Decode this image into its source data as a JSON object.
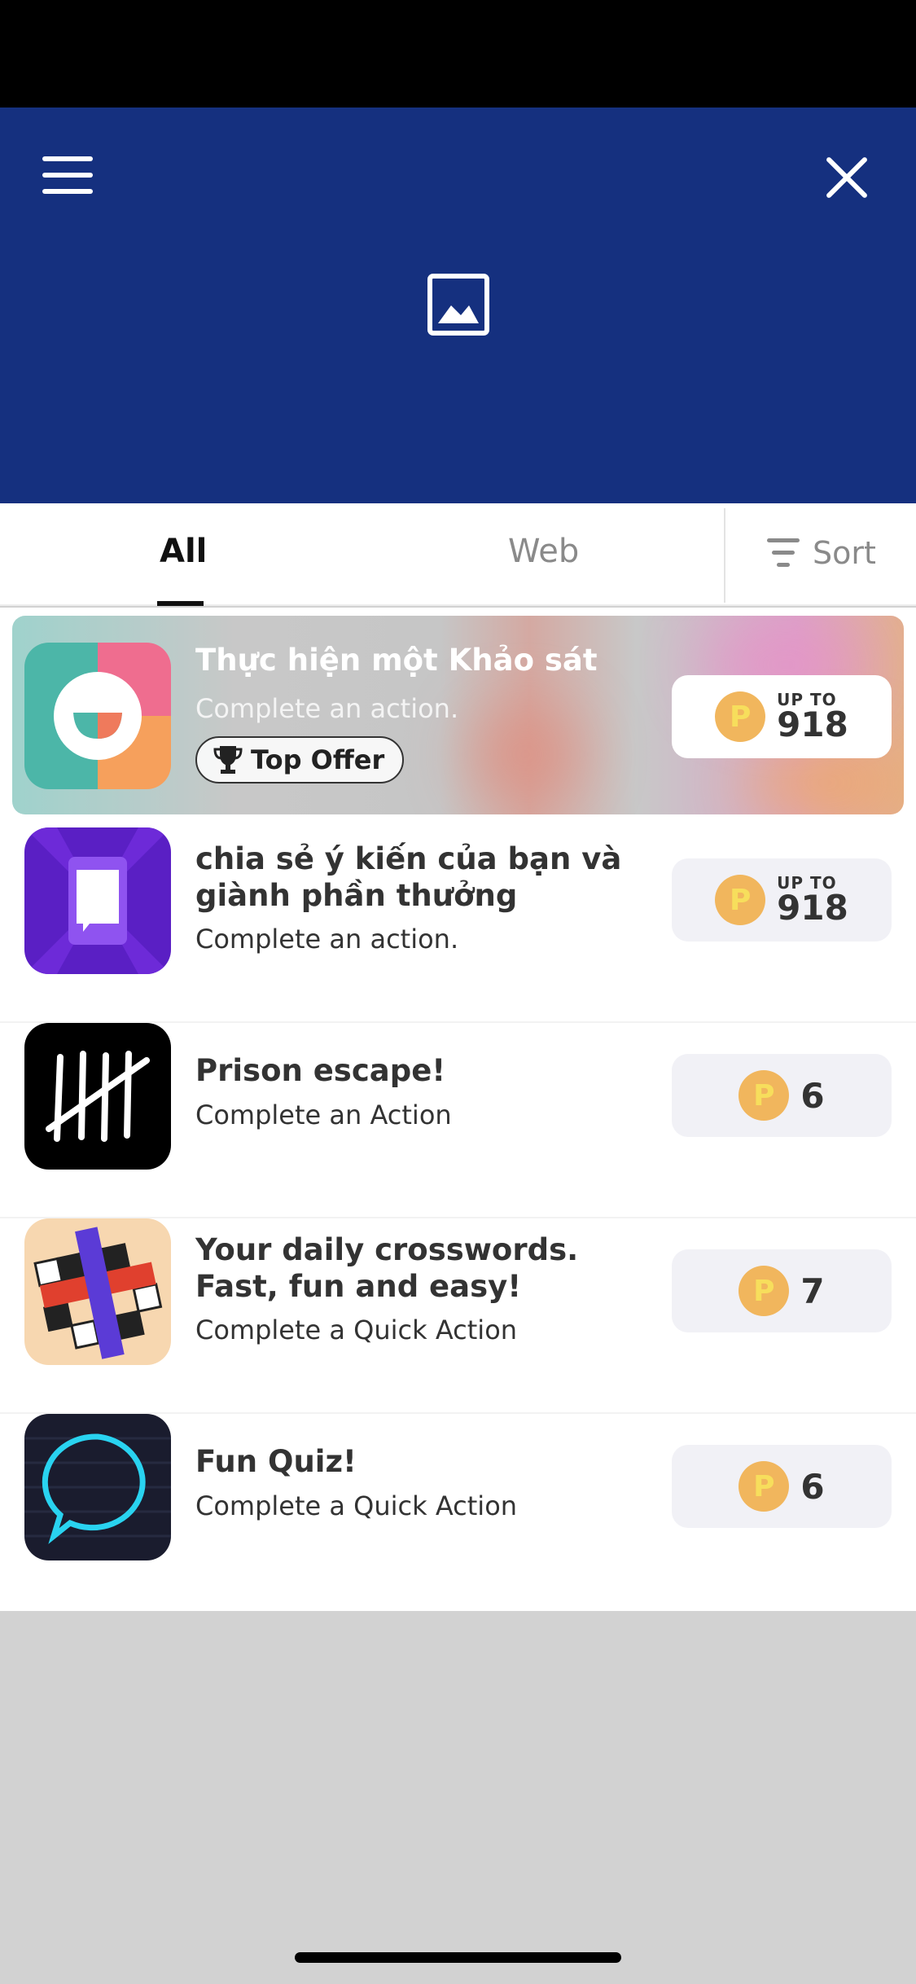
{
  "header": {
    "menu_icon": "hamburger-menu-icon",
    "close_icon": "close-icon",
    "banner_icon": "image-placeholder-icon",
    "background": "#15307f"
  },
  "tabs": {
    "all": "All",
    "web": "Web",
    "sort": "Sort"
  },
  "offers": [
    {
      "title": "Thực hiện một Khảo sát",
      "subtitle": "Complete an action.",
      "badge": "Top Offer",
      "reward_prefix": "UP TO",
      "reward": "918",
      "coin": "P",
      "icon": "survey-smile-icon"
    },
    {
      "title": "chia sẻ ý kiến của bạn và giành phần thưởng",
      "subtitle": "Complete an action.",
      "reward_prefix": "UP TO",
      "reward": "918",
      "coin": "P",
      "icon": "phone-chat-icon"
    },
    {
      "title": "Prison escape!",
      "subtitle": "Complete an Action",
      "reward": "6",
      "coin": "P",
      "icon": "tally-marks-icon"
    },
    {
      "title": "Your daily crosswords. Fast, fun and easy!",
      "subtitle": "Complete a Quick Action",
      "reward": "7",
      "coin": "P",
      "icon": "crossword-icon"
    },
    {
      "title": "Fun Quiz!",
      "subtitle": "Complete a Quick Action",
      "reward": "6",
      "coin": "P",
      "icon": "quiz-bubble-icon"
    }
  ],
  "colors": {
    "coin": "#f1b65d",
    "reward_bg": "#f1f1f6",
    "text": "#333333"
  }
}
